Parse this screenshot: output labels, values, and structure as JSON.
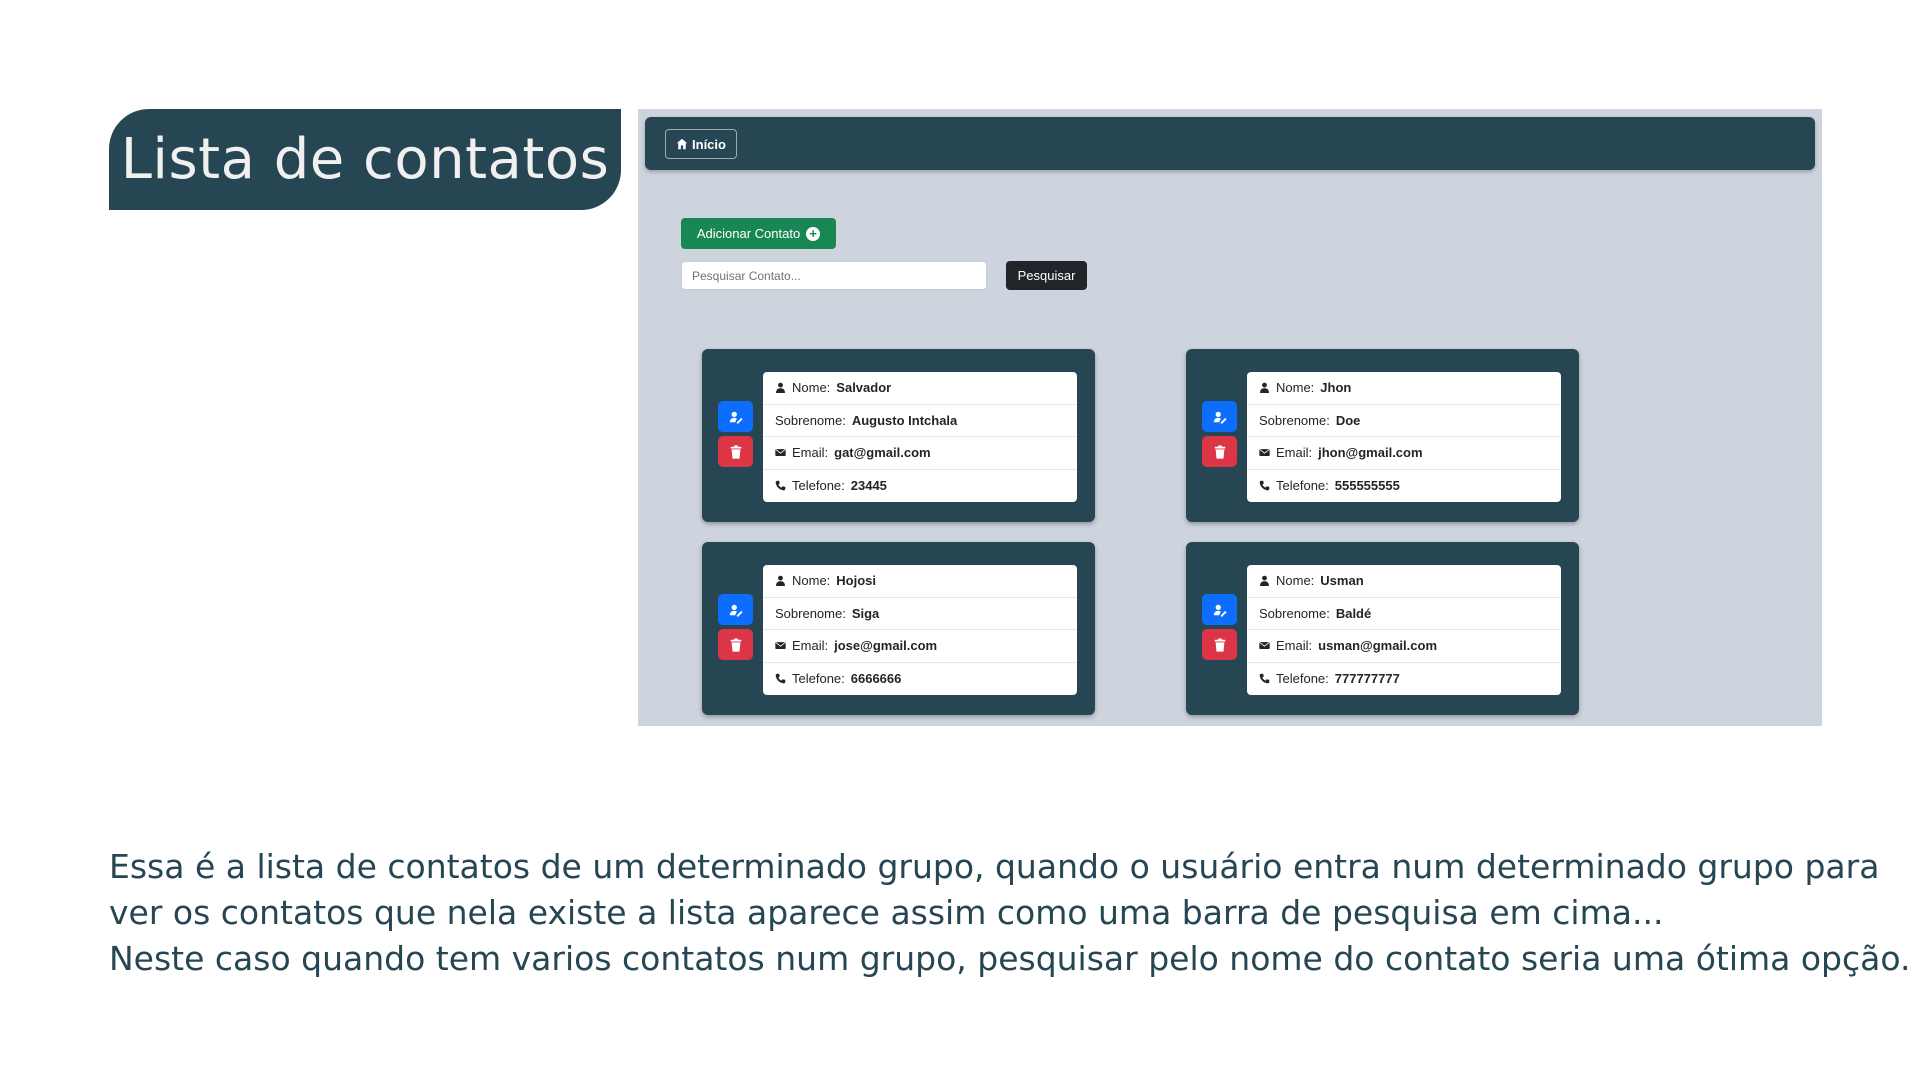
{
  "slide": {
    "title": "Lista de contatos",
    "description_lines": [
      "Essa é a lista de contatos de um determinado grupo, quando o usuário entra num determinado grupo para",
      "ver os contatos que nela existe a lista aparece assim como uma barra de pesquisa em cima...",
      "Neste caso quando tem varios contatos num  grupo, pesquisar pelo nome do contato seria uma ótima opção."
    ]
  },
  "app": {
    "nav": {
      "home_label": "Início",
      "home_icon": "home-icon"
    },
    "add_button_label": "Adicionar Contato",
    "search": {
      "placeholder": "Pesquisar Contato...",
      "value": "",
      "button_label": "Pesquisar"
    },
    "field_labels": {
      "nome": "Nome:",
      "sobrenome": "Sobrenome:",
      "email": "Email:",
      "telefone": "Telefone:"
    },
    "contacts": [
      {
        "nome": "Salvador",
        "sobrenome": "Augusto Intchala",
        "email": "gat@gmail.com",
        "telefone": "23445"
      },
      {
        "nome": "Jhon",
        "sobrenome": "Doe",
        "email": "jhon@gmail.com",
        "telefone": "555555555"
      },
      {
        "nome": "Hojosi",
        "sobrenome": "Siga",
        "email": "jose@gmail.com",
        "telefone": "6666666"
      },
      {
        "nome": "Usman",
        "sobrenome": "Baldé",
        "email": "usman@gmail.com",
        "telefone": "777777777"
      }
    ]
  },
  "colors": {
    "primary_dark": "#264653",
    "background_panel": "#ced4dd",
    "success": "#198754",
    "edit": "#0d6efd",
    "delete": "#dc3545",
    "search_button": "#212529"
  }
}
